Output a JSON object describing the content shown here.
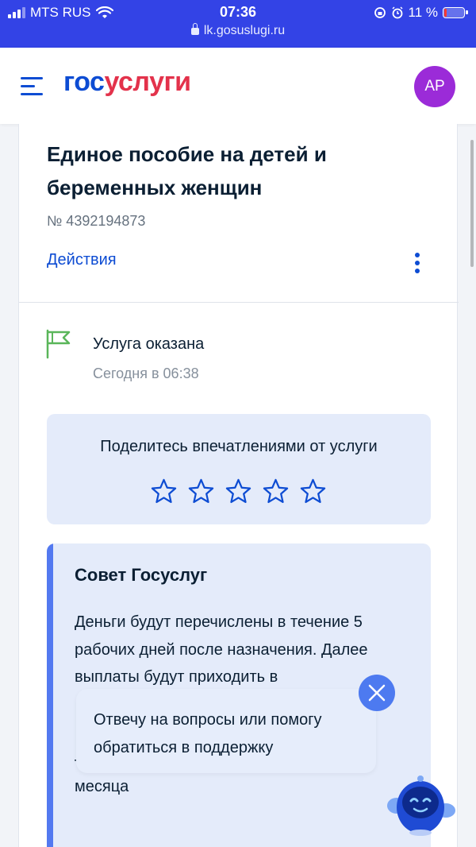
{
  "status_bar": {
    "carrier": "MTS RUS",
    "time": "07:36",
    "battery": "11 %",
    "url": "lk.gosuslugi.ru"
  },
  "header": {
    "logo_part1": "гос",
    "logo_part2": "услуги",
    "avatar_initials": "АР"
  },
  "service": {
    "title": "Единое пособие на детей и беременных женщин",
    "number": "№ 4392194873",
    "actions_label": "Действия"
  },
  "status": {
    "title": "Услуга оказана",
    "time": "Сегодня в 06:38"
  },
  "rating": {
    "prompt": "Поделитесь впечатлениями от услуги",
    "stars_count": 5
  },
  "tip": {
    "title": "Совет Госуслуг",
    "text": "Деньги будут перечислены в течение 5 рабочих дней после назначения. Далее выплаты будут приходить в"
  },
  "tip_tail": {
    "text": "— по почте — до 25 числа следующего месяца"
  },
  "chat": {
    "message": "Отвечу на вопросы или помогу обратиться в поддержку"
  },
  "colors": {
    "brand_blue": "#0d4cd3",
    "brand_red": "#e3324b",
    "status_bar": "#3343e6",
    "accent": "#5379f0",
    "success": "#5ab65a",
    "avatar": "#9b2bd8"
  }
}
